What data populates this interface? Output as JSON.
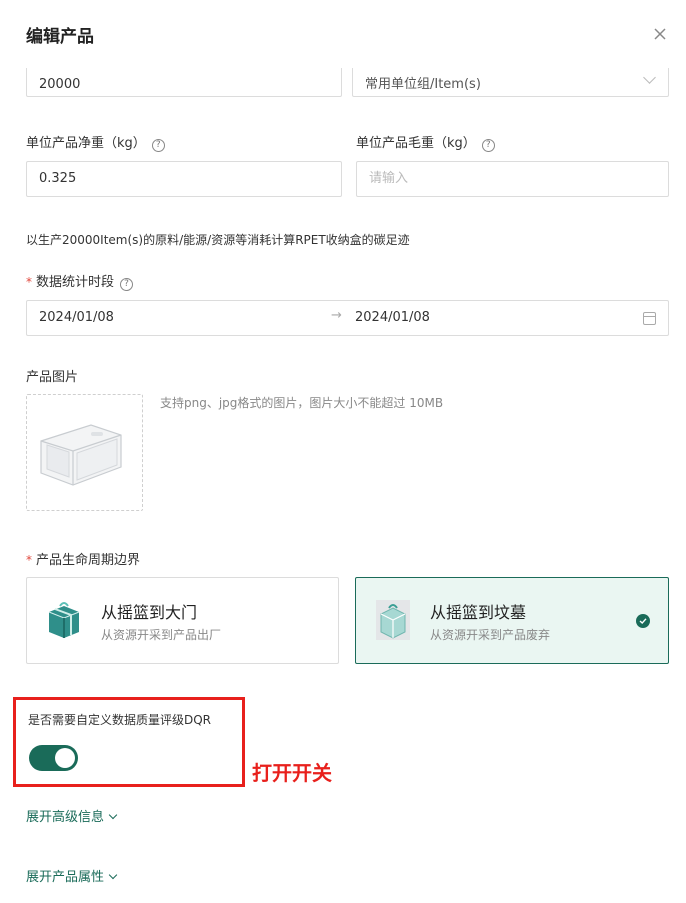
{
  "dialog": {
    "title": "编辑产品"
  },
  "top_row": {
    "quantity_value": "20000",
    "unit_value": "常用单位组/Item(s)"
  },
  "net_weight": {
    "label": "单位产品净重（kg）",
    "value": "0.325"
  },
  "gross_weight": {
    "label": "单位产品毛重（kg）",
    "placeholder": "请输入"
  },
  "description": "以生产20000Item(s)的原料/能源/资源等消耗计算RPET收纳盒的碳足迹",
  "period": {
    "required_mark": "*",
    "label": "数据统计时段",
    "start": "2024/01/08",
    "separator": "→",
    "end": "2024/01/08"
  },
  "image": {
    "label": "产品图片",
    "hint": "支持png、jpg格式的图片，图片大小不能超过 10MB"
  },
  "lifecycle": {
    "required_mark": "*",
    "label": "产品生命周期边界",
    "options": [
      {
        "title": "从摇篮到大门",
        "subtitle": "从资源开采到产品出厂",
        "selected": false
      },
      {
        "title": "从摇篮到坟墓",
        "subtitle": "从资源开采到产品废弃",
        "selected": true
      }
    ]
  },
  "dqr": {
    "label": "是否需要自定义数据质量评级DQR",
    "enabled": true
  },
  "annotation": "打开开关",
  "links": {
    "advanced": "展开高级信息",
    "attributes": "展开产品属性"
  },
  "colors": {
    "primary": "#1a6b59",
    "selected_bg": "#eaf6f2",
    "annotation": "#e8201c",
    "required": "#e0473d"
  }
}
